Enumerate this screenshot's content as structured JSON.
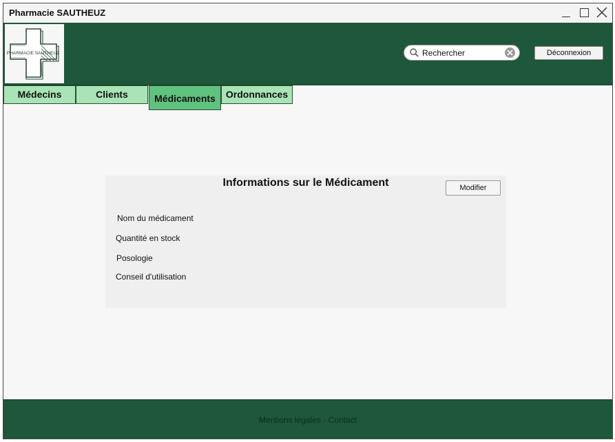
{
  "window": {
    "title": "Pharmacie SAUTHEUZ"
  },
  "logo": {
    "text": "PHARMACIE SAUTHEUZ"
  },
  "search": {
    "value": "Rechercher"
  },
  "header": {
    "logout_label": "Déconnexion"
  },
  "tabs": [
    {
      "label": "Médecins",
      "active": false
    },
    {
      "label": "Clients",
      "active": false
    },
    {
      "label": "Médicaments",
      "active": true
    },
    {
      "label": "Ordonnances",
      "active": false
    }
  ],
  "card": {
    "title": "Informations sur le Médicament",
    "edit_label": "Modifier",
    "fields": [
      "Nom du médicament",
      "Quantité en stock",
      "Posologie",
      "Conseil d'utilisation"
    ]
  },
  "footer": {
    "links": "Mentions légales - Contact"
  },
  "colors": {
    "header": "#1e5739",
    "tab": "#a9e4b6",
    "tab_active": "#5fc27e",
    "card": "#efefef"
  }
}
